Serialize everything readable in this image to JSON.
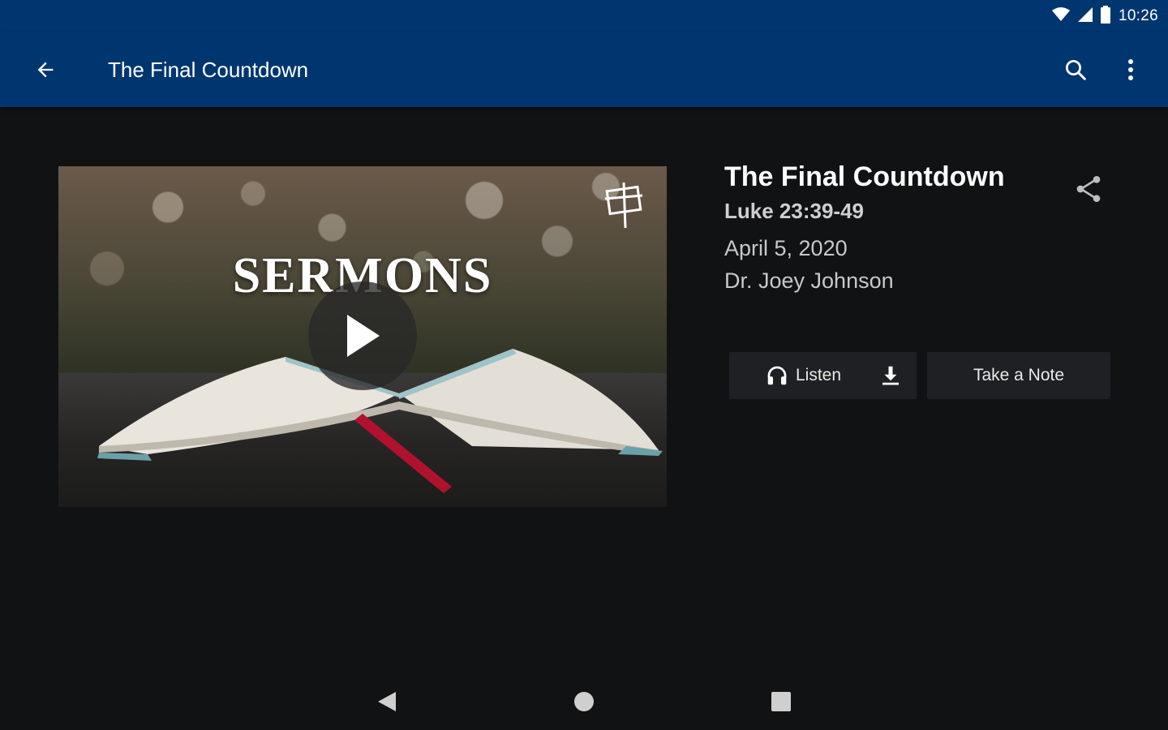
{
  "status_bar": {
    "time": "10:26",
    "icons": [
      "wifi-icon",
      "signal-icon",
      "battery-icon"
    ]
  },
  "app_bar": {
    "title": "The Final Countdown",
    "back_icon": "arrow-back-icon",
    "search_icon": "search-icon",
    "more_icon": "more-vert-icon",
    "background": "#003670"
  },
  "media": {
    "thumbnail_text": "SERMONS",
    "play_icon": "play-icon",
    "logo_icon": "church-logo-icon"
  },
  "sermon": {
    "title": "The Final Countdown",
    "reference": "Luke 23:39-49",
    "date": "April 5, 2020",
    "speaker": "Dr. Joey Johnson",
    "share_icon": "share-icon"
  },
  "actions": {
    "listen_label": "Listen",
    "listen_icon": "headphones-icon",
    "download_icon": "download-icon",
    "note_label": "Take a Note"
  },
  "nav_bar": {
    "back": "nav-back-icon",
    "home": "nav-home-icon",
    "recents": "nav-recents-icon"
  },
  "colors": {
    "background": "#111214",
    "button_bg": "#1f2023"
  }
}
